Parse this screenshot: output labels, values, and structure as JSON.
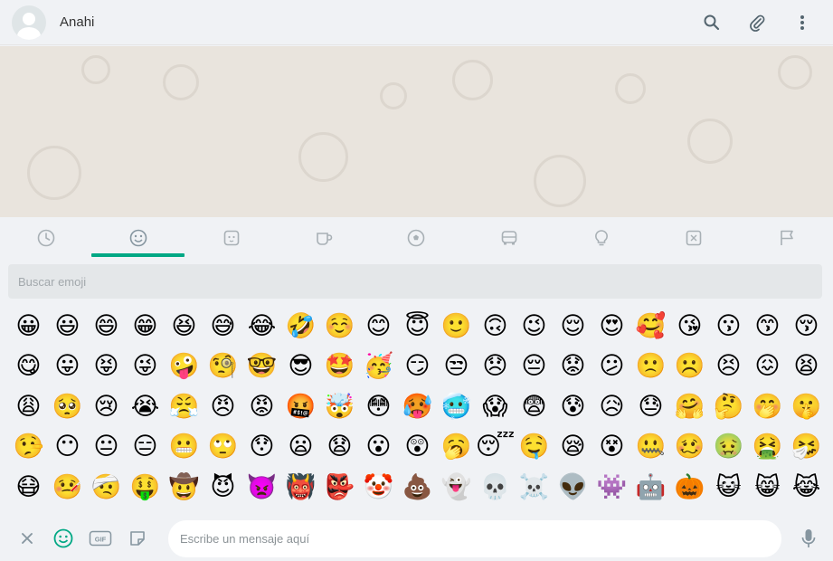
{
  "contact": {
    "name": "Anahi"
  },
  "header": {
    "icons": [
      "search-icon",
      "attach-icon",
      "menu-icon"
    ]
  },
  "emoji_tabs": [
    {
      "name": "recent",
      "icon": "clock-icon"
    },
    {
      "name": "smileys",
      "icon": "smiley-icon",
      "active": true
    },
    {
      "name": "animals",
      "icon": "animal-icon"
    },
    {
      "name": "food",
      "icon": "cup-icon"
    },
    {
      "name": "activity",
      "icon": "ball-icon"
    },
    {
      "name": "travel",
      "icon": "car-icon"
    },
    {
      "name": "objects",
      "icon": "bulb-icon"
    },
    {
      "name": "symbols",
      "icon": "symbols-icon"
    },
    {
      "name": "flags",
      "icon": "flag-icon"
    }
  ],
  "search": {
    "placeholder": "Buscar emoji"
  },
  "emoji_rows": [
    [
      "😀",
      "😃",
      "😄",
      "😁",
      "😆",
      "😅",
      "😂",
      "🤣",
      "☺️",
      "😊",
      "😇",
      "🙂",
      "🙃",
      "😉",
      "😌",
      "😍",
      "🥰",
      "😘",
      "😗",
      "😙",
      "😚"
    ],
    [
      "😋",
      "😛",
      "😝",
      "😜",
      "🤪",
      "🧐",
      "🤓",
      "😎",
      "🤩",
      "🥳",
      "😏",
      "😒",
      "😞",
      "😔",
      "😟",
      "😕",
      "🙁",
      "☹️",
      "😣",
      "😖",
      "😫"
    ],
    [
      "😩",
      "🥺",
      "😢",
      "😭",
      "😤",
      "😠",
      "😡",
      "🤬",
      "🤯",
      "😳",
      "🥵",
      "🥶",
      "😱",
      "😨",
      "😰",
      "😥",
      "😓",
      "🤗",
      "🤔",
      "🤭",
      "🤫"
    ],
    [
      "🤥",
      "😶",
      "😐",
      "😑",
      "😬",
      "🙄",
      "😯",
      "😦",
      "😧",
      "😮",
      "😲",
      "🥱",
      "😴",
      "🤤",
      "😪",
      "😵",
      "🤐",
      "🥴",
      "🤢",
      "🤮",
      "🤧"
    ],
    [
      "😷",
      "🤒",
      "🤕",
      "🤑",
      "🤠",
      "😈",
      "👿",
      "👹",
      "👺",
      "🤡",
      "💩",
      "👻",
      "💀",
      "☠️",
      "👽",
      "👾",
      "🤖",
      "🎃",
      "😺",
      "😸",
      "😹"
    ]
  ],
  "footer": {
    "input_placeholder": "Escribe un mensaje aquí",
    "gif_label": "GIF"
  },
  "colors": {
    "accent": "#00a884",
    "panel_bg": "#f0f2f5",
    "chat_bg": "#e9e4dd"
  }
}
